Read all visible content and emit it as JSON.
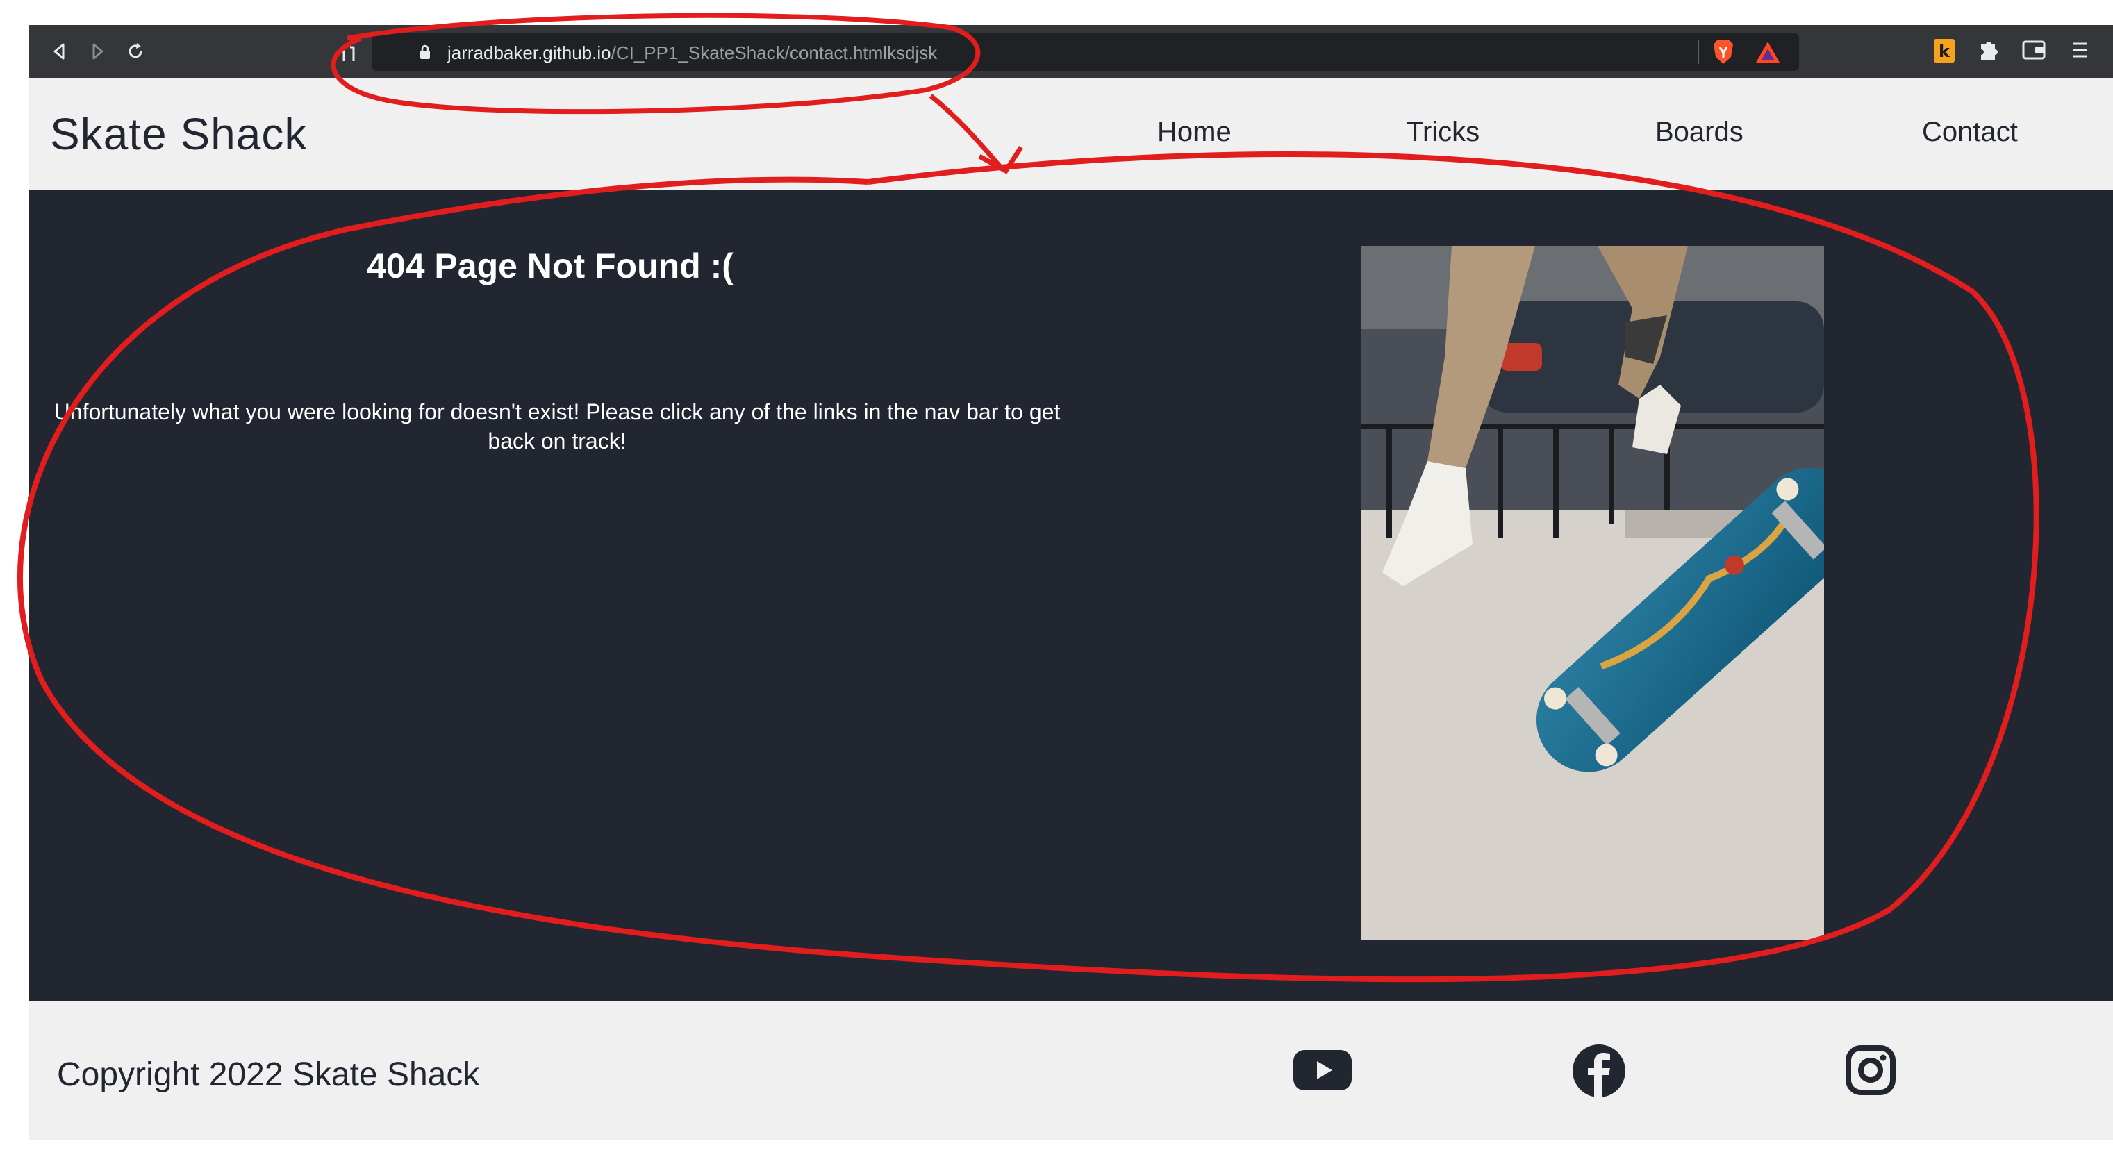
{
  "browser": {
    "url_host": "jarradbaker.github.io",
    "url_path": "/CI_PP1_SkateShack/contact.htmlksdjsk"
  },
  "site": {
    "logo": "Skate Shack",
    "nav": [
      "Home",
      "Tricks",
      "Boards",
      "Contact"
    ]
  },
  "main": {
    "heading": "404 Page Not Found :(",
    "message": "Unfortunately what you were looking for doesn't exist! Please click any of the links in the nav bar to get back on track!"
  },
  "footer": {
    "copyright": "Copyright 2022 Skate Shack",
    "social": [
      "youtube-icon",
      "facebook-icon",
      "instagram-icon"
    ]
  },
  "colors": {
    "header_bg": "#f0f0f0",
    "main_bg": "#212631",
    "annotation": "#e11d1d"
  }
}
